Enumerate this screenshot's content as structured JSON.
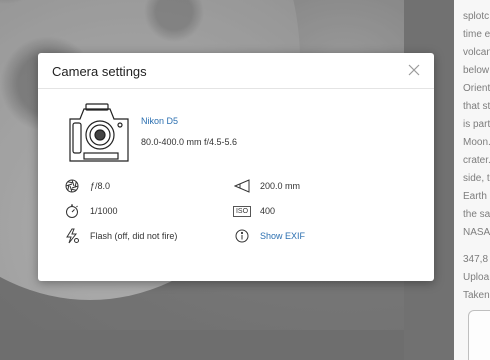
{
  "modal": {
    "title": "Camera settings",
    "camera_model": "Nikon D5",
    "lens": "80.0-400.0 mm f/4.5-5.6",
    "aperture": "ƒ/8.0",
    "focal_length": "200.0 mm",
    "shutter": "1/1000",
    "iso": "400",
    "iso_icon_label": "ISO",
    "flash": "Flash (off, did not fire)",
    "show_exif": "Show EXIF"
  },
  "side_panel": {
    "lines": [
      "splotc",
      "time e",
      "volcan",
      "below",
      "Orient",
      "that st",
      "is part",
      "Moon.",
      "crater.",
      "side, t",
      "Earth I",
      "the sa",
      "NASA",
      "",
      "347,8",
      "Uploa",
      "Taken"
    ]
  },
  "colors": {
    "link": "#2b6fb0",
    "text": "#333333",
    "modal_bg": "#ffffff"
  },
  "icons": {
    "close": "close-icon",
    "aperture": "aperture-icon",
    "focal": "focal-length-icon",
    "shutter": "timer-icon",
    "iso": "iso-icon",
    "flash": "flash-off-icon",
    "info": "info-icon",
    "next": "chevron-right-icon"
  }
}
